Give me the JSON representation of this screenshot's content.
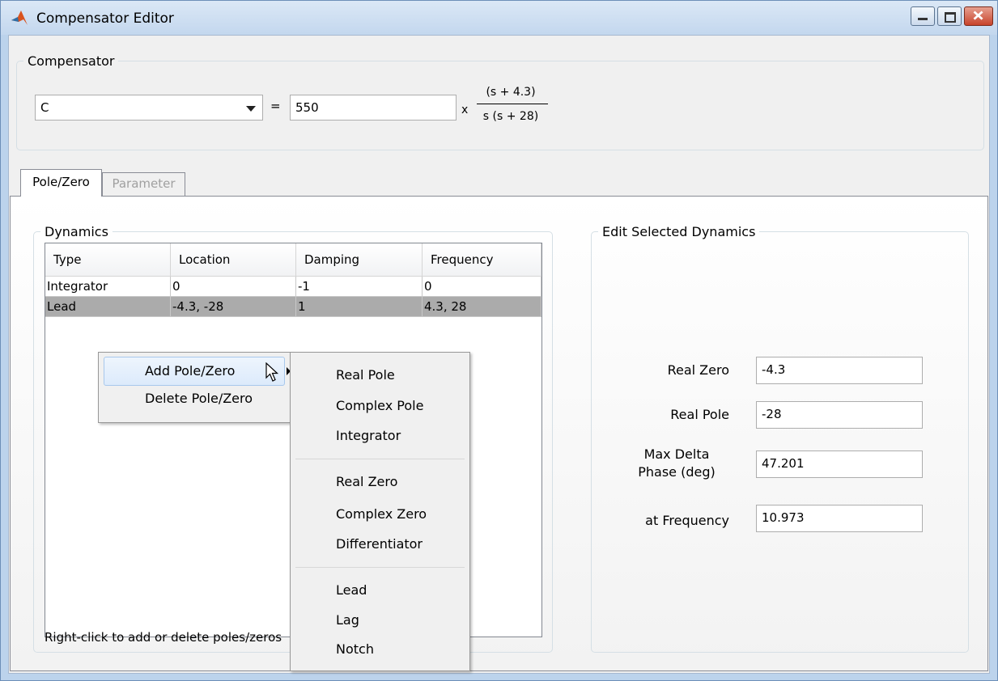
{
  "window": {
    "title": "Compensator Editor"
  },
  "compensator": {
    "legend": "Compensator",
    "selected": "C",
    "equals": "=",
    "gain": "550",
    "times": "x",
    "numerator": "(s + 4.3)",
    "denominator": "s (s + 28)"
  },
  "tabs": [
    {
      "label": "Pole/Zero",
      "active": true
    },
    {
      "label": "Parameter",
      "active": false
    }
  ],
  "dynamics": {
    "legend": "Dynamics",
    "columns": [
      "Type",
      "Location",
      "Damping",
      "Frequency"
    ],
    "rows": [
      {
        "type": "Integrator",
        "location": "0",
        "damping": "-1",
        "frequency": "0",
        "selected": false
      },
      {
        "type": "Lead",
        "location": "-4.3, -28",
        "damping": "1",
        "frequency": "4.3, 28",
        "selected": true
      }
    ],
    "hint": "Right-click to add or delete poles/zeros"
  },
  "context_menu": {
    "items": [
      "Add Pole/Zero",
      "Delete Pole/Zero"
    ]
  },
  "submenu": {
    "groups": [
      [
        "Real Pole",
        "Complex Pole",
        "Integrator"
      ],
      [
        "Real Zero",
        "Complex Zero",
        "Differentiator"
      ],
      [
        "Lead",
        "Lag",
        "Notch"
      ]
    ]
  },
  "edit": {
    "legend": "Edit Selected Dynamics",
    "fields": [
      {
        "label": "Real Zero",
        "value": "-4.3"
      },
      {
        "label": "Real Pole",
        "value": "-28"
      },
      {
        "label_line1": "Max Delta",
        "label_line2": "Phase (deg)",
        "value": "47.201"
      },
      {
        "label": "at Frequency",
        "value": "10.973"
      }
    ]
  }
}
